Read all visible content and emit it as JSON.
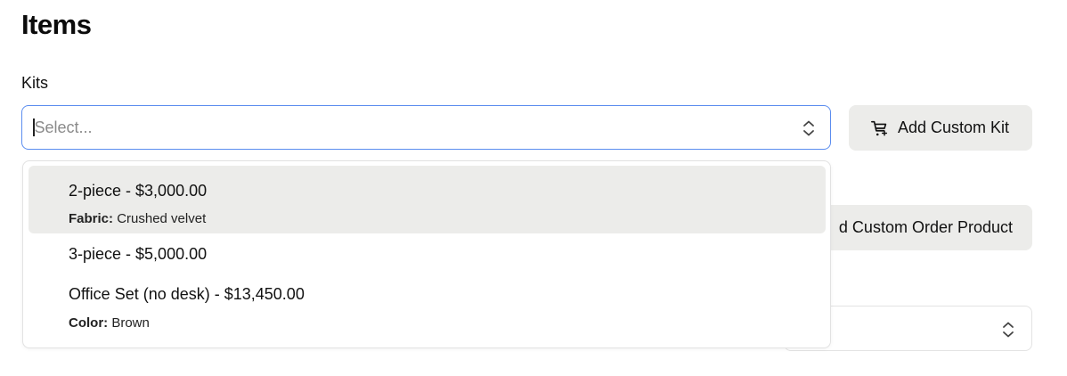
{
  "page": {
    "title": "Items"
  },
  "kits": {
    "label": "Kits",
    "placeholder": "Select...",
    "options": [
      {
        "label": "2-piece - $3,000.00",
        "meta_key": "Fabric:",
        "meta_value": "Crushed velvet",
        "highlighted": true
      },
      {
        "label": "3-piece - $5,000.00",
        "meta_key": "",
        "meta_value": ""
      },
      {
        "label": "Office Set (no desk) - $13,450.00",
        "meta_key": "Color:",
        "meta_value": "Brown"
      }
    ]
  },
  "buttons": {
    "add_custom_kit": "Add Custom Kit",
    "add_custom_order_product_visible": "d Custom Order Product"
  },
  "icons": {
    "chevron": "chevron-up-down-icon",
    "kit": "cart-add-icon"
  },
  "colors": {
    "focus_border": "#5b8def",
    "button_bg": "#ececea",
    "highlight_bg": "#ececea"
  }
}
